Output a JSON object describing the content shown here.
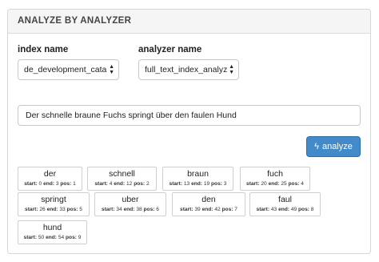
{
  "panel": {
    "title": "ANALYZE BY ANALYZER"
  },
  "form": {
    "index_label": "index name",
    "index_value": "de_development_cata",
    "analyzer_label": "analyzer name",
    "analyzer_value": "full_text_index_analyz",
    "text_value": "Der schnelle braune Fuchs springt über den faulen Hund",
    "analyze_label": "analyze",
    "analyze_icon": "bolt-icon"
  },
  "tokens": [
    {
      "term": "der",
      "start": "0",
      "end": "3",
      "pos": "1"
    },
    {
      "term": "schnell",
      "start": "4",
      "end": "12",
      "pos": "2"
    },
    {
      "term": "braun",
      "start": "13",
      "end": "19",
      "pos": "3"
    },
    {
      "term": "fuch",
      "start": "20",
      "end": "25",
      "pos": "4"
    },
    {
      "term": "springt",
      "start": "26",
      "end": "33",
      "pos": "5"
    },
    {
      "term": "uber",
      "start": "34",
      "end": "38",
      "pos": "6"
    },
    {
      "term": "den",
      "start": "39",
      "end": "42",
      "pos": "7"
    },
    {
      "term": "faul",
      "start": "43",
      "end": "49",
      "pos": "8"
    },
    {
      "term": "hund",
      "start": "50",
      "end": "54",
      "pos": "9"
    }
  ],
  "labels": {
    "start": "start:",
    "end": "end:",
    "pos": "pos:"
  },
  "colors": {
    "button": "#428bca",
    "heading_bg": "#f5f5f5"
  }
}
